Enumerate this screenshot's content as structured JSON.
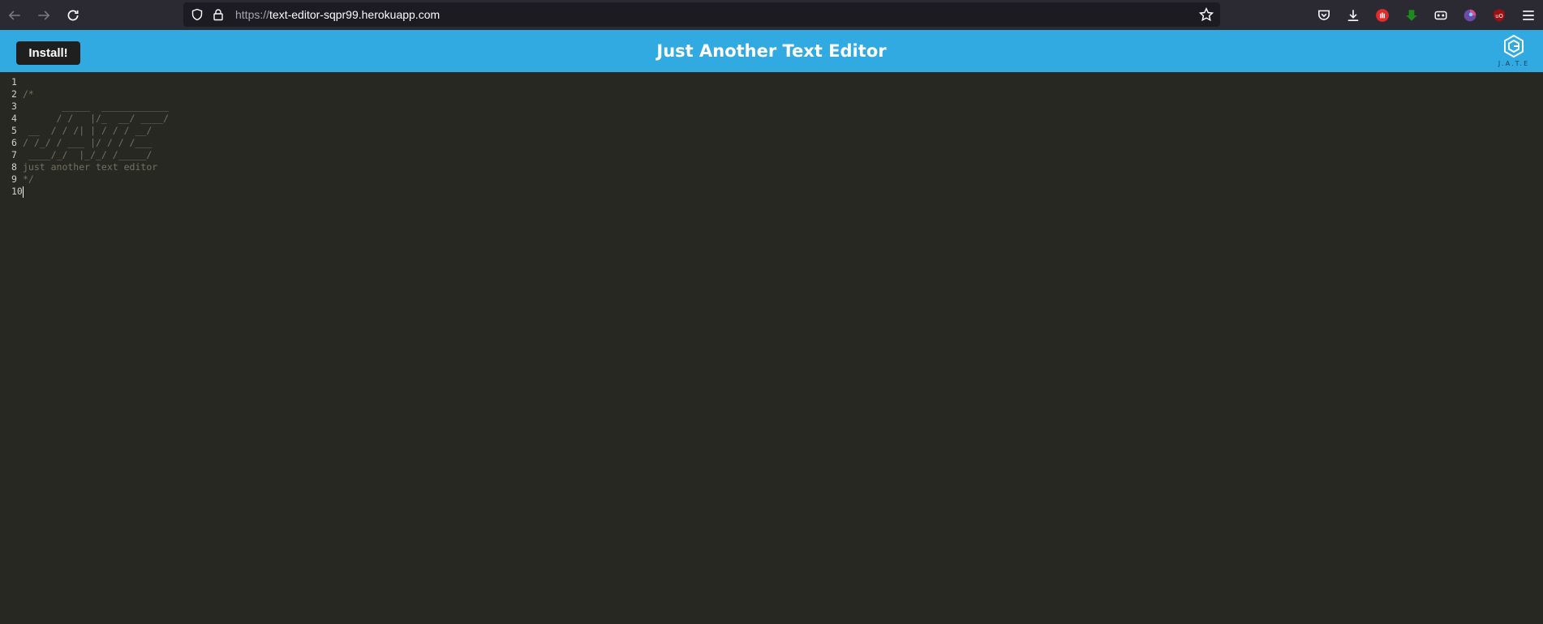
{
  "browser": {
    "url_protocol": "https://",
    "url_host": "text-editor-sqpr99.herokuapp.com"
  },
  "app": {
    "install_label": "Install!",
    "title": "Just Another Text Editor",
    "logo_text": "J.A.T.E",
    "header_color": "#31a9e1"
  },
  "editor": {
    "lines": [
      {
        "num": "1",
        "text": ""
      },
      {
        "num": "2",
        "text": "/*"
      },
      {
        "num": "3",
        "text": "       _____  ____________"
      },
      {
        "num": "4",
        "text": "      / /   |/_  __/ ____/"
      },
      {
        "num": "5",
        "text": " __  / / /| | / / / __/"
      },
      {
        "num": "6",
        "text": "/ /_/ / ___ |/ / / /___"
      },
      {
        "num": "7",
        "text": " ____/_/  |_/_/ /_____/"
      },
      {
        "num": "8",
        "text": "just another text editor"
      },
      {
        "num": "9",
        "text": "*/"
      },
      {
        "num": "10",
        "text": ""
      }
    ]
  }
}
